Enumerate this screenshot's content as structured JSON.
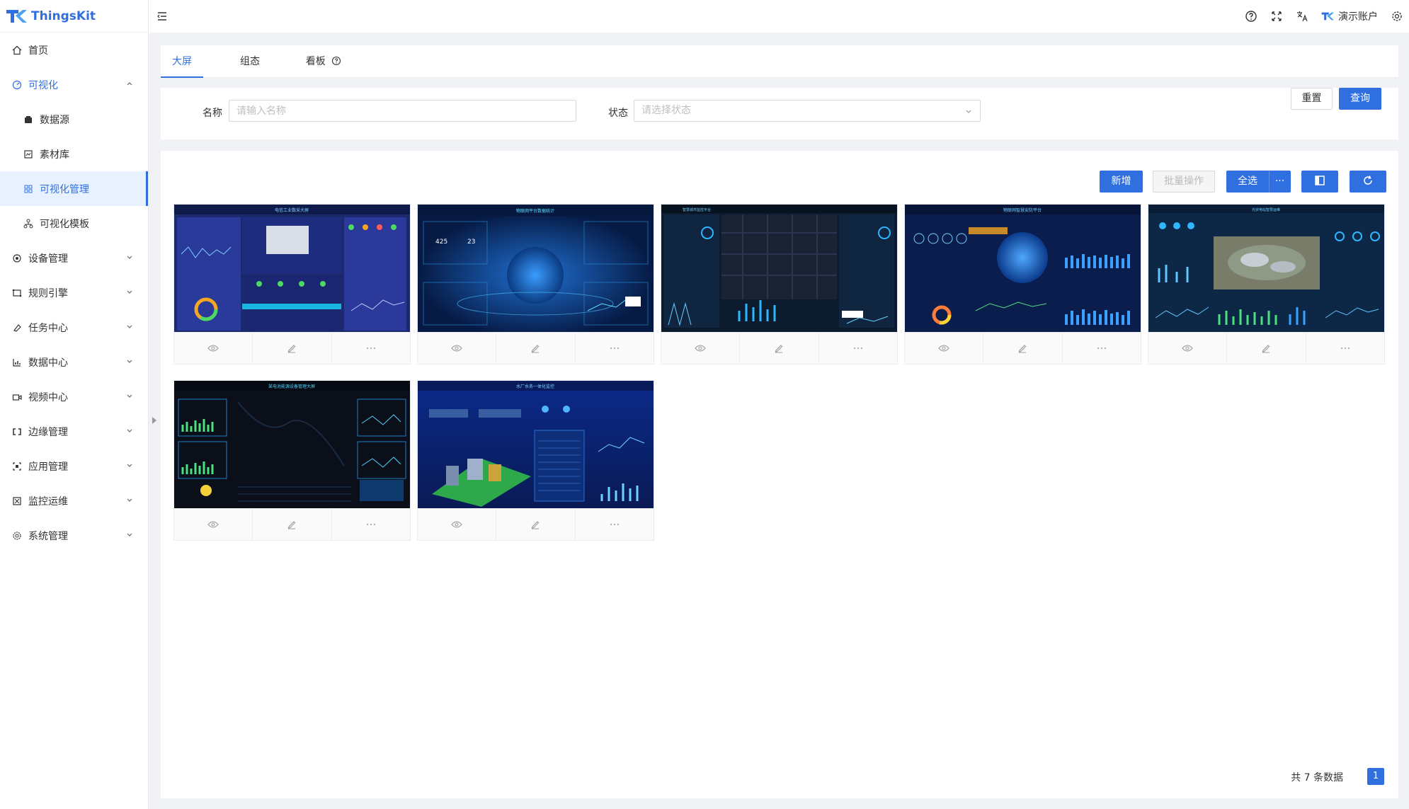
{
  "app": {
    "name": "ThingsKit"
  },
  "sidebar": {
    "items": [
      {
        "label": "首页",
        "icon": "home-icon"
      },
      {
        "label": "可视化",
        "icon": "dashboard-icon"
      },
      {
        "label": "数据源",
        "icon": "database-icon"
      },
      {
        "label": "素材库",
        "icon": "material-icon"
      },
      {
        "label": "可视化管理",
        "icon": "grid-icon"
      },
      {
        "label": "可视化模板",
        "icon": "template-icon"
      },
      {
        "label": "设备管理",
        "icon": "device-icon"
      },
      {
        "label": "规则引擎",
        "icon": "rule-icon"
      },
      {
        "label": "任务中心",
        "icon": "task-icon"
      },
      {
        "label": "数据中心",
        "icon": "chart-icon"
      },
      {
        "label": "视频中心",
        "icon": "video-icon"
      },
      {
        "label": "边缘管理",
        "icon": "edge-icon"
      },
      {
        "label": "应用管理",
        "icon": "app-icon"
      },
      {
        "label": "监控运维",
        "icon": "monitor-icon"
      },
      {
        "label": "系统管理",
        "icon": "settings-icon"
      }
    ]
  },
  "header": {
    "account": "演示账户"
  },
  "tabs": [
    {
      "label": "大屏"
    },
    {
      "label": "组态"
    },
    {
      "label": "看板"
    }
  ],
  "search": {
    "name_label": "名称",
    "name_placeholder": "请输入名称",
    "status_label": "状态",
    "status_placeholder": "请选择状态",
    "reset": "重置",
    "query": "查询"
  },
  "toolbar": {
    "add": "新增",
    "batch": "批量操作",
    "select_all": "全选",
    "more": "···"
  },
  "cards": [
    {
      "title": "电信工业数采大屏"
    },
    {
      "title": "物联网平台数据统计"
    },
    {
      "title": "智慧城市监控平台"
    },
    {
      "title": "物联网智慧安防平台"
    },
    {
      "title": "光伏电站智慧运维"
    },
    {
      "title": "某电池能源设备管理大屏"
    },
    {
      "title": "水厂水务一体化监控"
    }
  ],
  "pagination": {
    "total_text": "共 7 条数据",
    "current_page": "1"
  },
  "colors": {
    "primary": "#2f6fe0"
  }
}
